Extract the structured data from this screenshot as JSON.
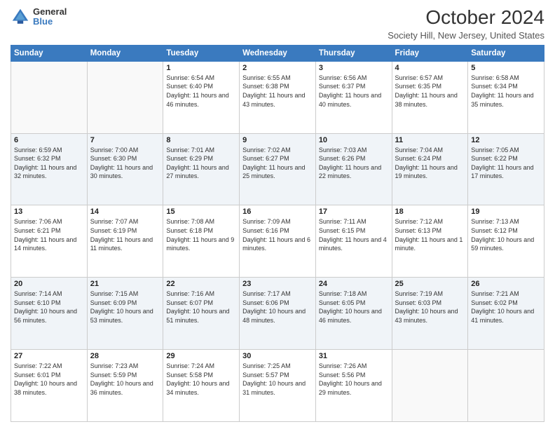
{
  "header": {
    "logo_line1": "General",
    "logo_line2": "Blue",
    "month_year": "October 2024",
    "location": "Society Hill, New Jersey, United States"
  },
  "days_of_week": [
    "Sunday",
    "Monday",
    "Tuesday",
    "Wednesday",
    "Thursday",
    "Friday",
    "Saturday"
  ],
  "weeks": [
    [
      {
        "day": "",
        "sunrise": "",
        "sunset": "",
        "daylight": ""
      },
      {
        "day": "",
        "sunrise": "",
        "sunset": "",
        "daylight": ""
      },
      {
        "day": "1",
        "sunrise": "Sunrise: 6:54 AM",
        "sunset": "Sunset: 6:40 PM",
        "daylight": "Daylight: 11 hours and 46 minutes."
      },
      {
        "day": "2",
        "sunrise": "Sunrise: 6:55 AM",
        "sunset": "Sunset: 6:38 PM",
        "daylight": "Daylight: 11 hours and 43 minutes."
      },
      {
        "day": "3",
        "sunrise": "Sunrise: 6:56 AM",
        "sunset": "Sunset: 6:37 PM",
        "daylight": "Daylight: 11 hours and 40 minutes."
      },
      {
        "day": "4",
        "sunrise": "Sunrise: 6:57 AM",
        "sunset": "Sunset: 6:35 PM",
        "daylight": "Daylight: 11 hours and 38 minutes."
      },
      {
        "day": "5",
        "sunrise": "Sunrise: 6:58 AM",
        "sunset": "Sunset: 6:34 PM",
        "daylight": "Daylight: 11 hours and 35 minutes."
      }
    ],
    [
      {
        "day": "6",
        "sunrise": "Sunrise: 6:59 AM",
        "sunset": "Sunset: 6:32 PM",
        "daylight": "Daylight: 11 hours and 32 minutes."
      },
      {
        "day": "7",
        "sunrise": "Sunrise: 7:00 AM",
        "sunset": "Sunset: 6:30 PM",
        "daylight": "Daylight: 11 hours and 30 minutes."
      },
      {
        "day": "8",
        "sunrise": "Sunrise: 7:01 AM",
        "sunset": "Sunset: 6:29 PM",
        "daylight": "Daylight: 11 hours and 27 minutes."
      },
      {
        "day": "9",
        "sunrise": "Sunrise: 7:02 AM",
        "sunset": "Sunset: 6:27 PM",
        "daylight": "Daylight: 11 hours and 25 minutes."
      },
      {
        "day": "10",
        "sunrise": "Sunrise: 7:03 AM",
        "sunset": "Sunset: 6:26 PM",
        "daylight": "Daylight: 11 hours and 22 minutes."
      },
      {
        "day": "11",
        "sunrise": "Sunrise: 7:04 AM",
        "sunset": "Sunset: 6:24 PM",
        "daylight": "Daylight: 11 hours and 19 minutes."
      },
      {
        "day": "12",
        "sunrise": "Sunrise: 7:05 AM",
        "sunset": "Sunset: 6:22 PM",
        "daylight": "Daylight: 11 hours and 17 minutes."
      }
    ],
    [
      {
        "day": "13",
        "sunrise": "Sunrise: 7:06 AM",
        "sunset": "Sunset: 6:21 PM",
        "daylight": "Daylight: 11 hours and 14 minutes."
      },
      {
        "day": "14",
        "sunrise": "Sunrise: 7:07 AM",
        "sunset": "Sunset: 6:19 PM",
        "daylight": "Daylight: 11 hours and 11 minutes."
      },
      {
        "day": "15",
        "sunrise": "Sunrise: 7:08 AM",
        "sunset": "Sunset: 6:18 PM",
        "daylight": "Daylight: 11 hours and 9 minutes."
      },
      {
        "day": "16",
        "sunrise": "Sunrise: 7:09 AM",
        "sunset": "Sunset: 6:16 PM",
        "daylight": "Daylight: 11 hours and 6 minutes."
      },
      {
        "day": "17",
        "sunrise": "Sunrise: 7:11 AM",
        "sunset": "Sunset: 6:15 PM",
        "daylight": "Daylight: 11 hours and 4 minutes."
      },
      {
        "day": "18",
        "sunrise": "Sunrise: 7:12 AM",
        "sunset": "Sunset: 6:13 PM",
        "daylight": "Daylight: 11 hours and 1 minute."
      },
      {
        "day": "19",
        "sunrise": "Sunrise: 7:13 AM",
        "sunset": "Sunset: 6:12 PM",
        "daylight": "Daylight: 10 hours and 59 minutes."
      }
    ],
    [
      {
        "day": "20",
        "sunrise": "Sunrise: 7:14 AM",
        "sunset": "Sunset: 6:10 PM",
        "daylight": "Daylight: 10 hours and 56 minutes."
      },
      {
        "day": "21",
        "sunrise": "Sunrise: 7:15 AM",
        "sunset": "Sunset: 6:09 PM",
        "daylight": "Daylight: 10 hours and 53 minutes."
      },
      {
        "day": "22",
        "sunrise": "Sunrise: 7:16 AM",
        "sunset": "Sunset: 6:07 PM",
        "daylight": "Daylight: 10 hours and 51 minutes."
      },
      {
        "day": "23",
        "sunrise": "Sunrise: 7:17 AM",
        "sunset": "Sunset: 6:06 PM",
        "daylight": "Daylight: 10 hours and 48 minutes."
      },
      {
        "day": "24",
        "sunrise": "Sunrise: 7:18 AM",
        "sunset": "Sunset: 6:05 PM",
        "daylight": "Daylight: 10 hours and 46 minutes."
      },
      {
        "day": "25",
        "sunrise": "Sunrise: 7:19 AM",
        "sunset": "Sunset: 6:03 PM",
        "daylight": "Daylight: 10 hours and 43 minutes."
      },
      {
        "day": "26",
        "sunrise": "Sunrise: 7:21 AM",
        "sunset": "Sunset: 6:02 PM",
        "daylight": "Daylight: 10 hours and 41 minutes."
      }
    ],
    [
      {
        "day": "27",
        "sunrise": "Sunrise: 7:22 AM",
        "sunset": "Sunset: 6:01 PM",
        "daylight": "Daylight: 10 hours and 38 minutes."
      },
      {
        "day": "28",
        "sunrise": "Sunrise: 7:23 AM",
        "sunset": "Sunset: 5:59 PM",
        "daylight": "Daylight: 10 hours and 36 minutes."
      },
      {
        "day": "29",
        "sunrise": "Sunrise: 7:24 AM",
        "sunset": "Sunset: 5:58 PM",
        "daylight": "Daylight: 10 hours and 34 minutes."
      },
      {
        "day": "30",
        "sunrise": "Sunrise: 7:25 AM",
        "sunset": "Sunset: 5:57 PM",
        "daylight": "Daylight: 10 hours and 31 minutes."
      },
      {
        "day": "31",
        "sunrise": "Sunrise: 7:26 AM",
        "sunset": "Sunset: 5:56 PM",
        "daylight": "Daylight: 10 hours and 29 minutes."
      },
      {
        "day": "",
        "sunrise": "",
        "sunset": "",
        "daylight": ""
      },
      {
        "day": "",
        "sunrise": "",
        "sunset": "",
        "daylight": ""
      }
    ]
  ]
}
